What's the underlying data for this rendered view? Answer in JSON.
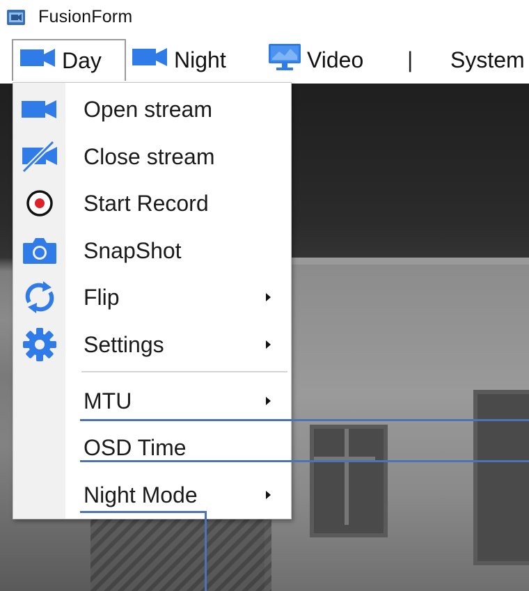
{
  "app": {
    "title": "FusionForm",
    "icon": "camera-app-icon"
  },
  "menubar": {
    "items": [
      {
        "label": "Day",
        "icon": "video-camera-icon",
        "active": true
      },
      {
        "label": "Night",
        "icon": "video-camera-icon",
        "active": false
      },
      {
        "label": "Video",
        "icon": "monitor-icon",
        "active": false
      },
      {
        "label": "|",
        "icon": null,
        "active": false
      },
      {
        "label": "System",
        "icon": null,
        "active": false
      }
    ]
  },
  "dropdown": {
    "items": [
      {
        "label": "Open stream",
        "icon": "video-camera-icon",
        "submenu": false
      },
      {
        "label": "Close stream",
        "icon": "camera-off-icon",
        "submenu": false
      },
      {
        "label": "Start Record",
        "icon": "record-icon",
        "submenu": false
      },
      {
        "label": "SnapShot",
        "icon": "photo-camera-icon",
        "submenu": false
      },
      {
        "label": "Flip",
        "icon": "flip-icon",
        "submenu": true
      },
      {
        "label": "Settings",
        "icon": "gear-icon",
        "submenu": true
      },
      {
        "label": "MTU",
        "icon": null,
        "submenu": true
      },
      {
        "label": "OSD Time",
        "icon": null,
        "submenu": false
      },
      {
        "label": "Night Mode",
        "icon": null,
        "submenu": true
      }
    ]
  },
  "colors": {
    "accent_blue": "#2f7be8",
    "callout_line": "#4a74b4",
    "gutter": "#f1f1f1"
  }
}
